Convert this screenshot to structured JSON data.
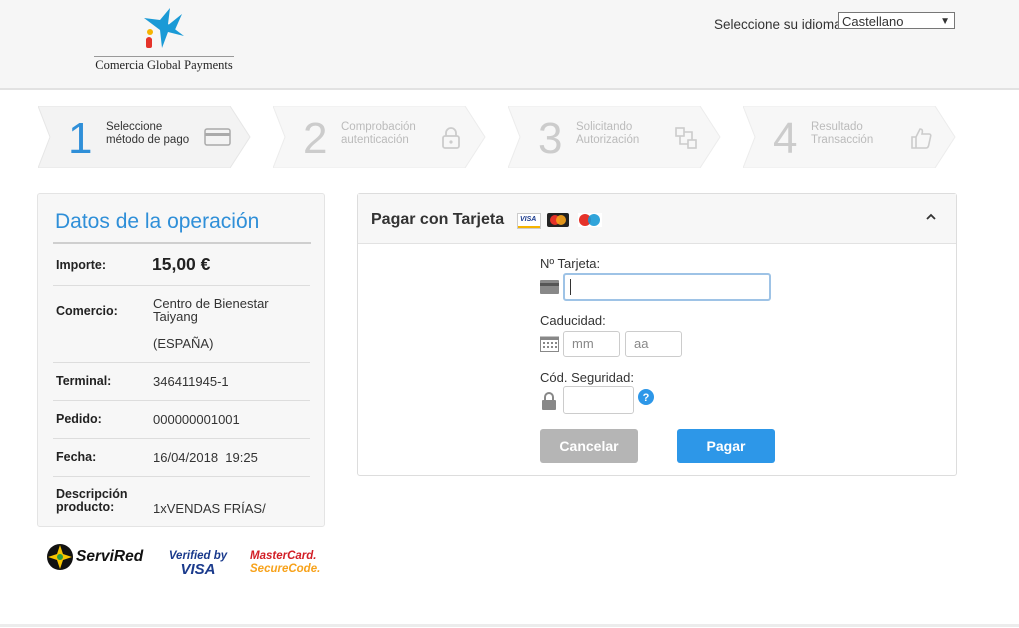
{
  "header": {
    "logo_text": "Comercia Global Payments",
    "language_label": "Seleccione su idioma",
    "language_selected": "Castellano"
  },
  "steps": [
    {
      "number": "1",
      "label_line1": "Seleccione",
      "label_line2": "método de pago",
      "active": true,
      "icon": "card-icon"
    },
    {
      "number": "2",
      "label_line1": "Comprobación",
      "label_line2": "autenticación",
      "active": false,
      "icon": "lock-icon"
    },
    {
      "number": "3",
      "label_line1": "Solicitando",
      "label_line2": "Autorización",
      "active": false,
      "icon": "transfer-icon"
    },
    {
      "number": "4",
      "label_line1": "Resultado",
      "label_line2": "Transacción",
      "active": false,
      "icon": "thumbs-up-icon"
    }
  ],
  "operation": {
    "title": "Datos de la operación",
    "importe_label": "Importe:",
    "importe_value": "15,00 €",
    "comercio_label": "Comercio:",
    "comercio_line1": "Centro de Bienestar",
    "comercio_line2": "Taiyang",
    "comercio_line3": "(ESPAÑA)",
    "terminal_label": "Terminal:",
    "terminal_value": "346411945-1",
    "pedido_label": "Pedido:",
    "pedido_value": "000000001001",
    "fecha_label": "Fecha:",
    "fecha_value": "16/04/2018  19:25",
    "descripcion_label_line1": "Descripción",
    "descripcion_label_line2": "producto:",
    "descripcion_value": "1xVENDAS FRÍAS/"
  },
  "security_brands": {
    "servired": "ServiRed",
    "verified_line1": "Verified by",
    "verified_line2": "VISA",
    "mastercard_line1": "MasterCard.",
    "mastercard_line2": "SecureCode."
  },
  "payment": {
    "title": "Pagar con Tarjeta",
    "card_brands": {
      "visa": "VISA",
      "mastercard": "MasterCard",
      "maestro": "Maestro"
    },
    "card_number_label": "Nº Tarjeta:",
    "card_number_value": "",
    "expiry_label": "Caducidad:",
    "month_placeholder": "mm",
    "year_placeholder": "aa",
    "cvv_label": "Cód. Seguridad:",
    "cvv_value": "",
    "cancel_label": "Cancelar",
    "pay_label": "Pagar"
  },
  "colors": {
    "accent": "#2f8fd8",
    "pay_button": "#2d97e8",
    "cancel_button": "#b5b5b5",
    "logo_blue": "#1a9ad6",
    "logo_red": "#e5332a",
    "logo_yellow": "#f6b400"
  }
}
